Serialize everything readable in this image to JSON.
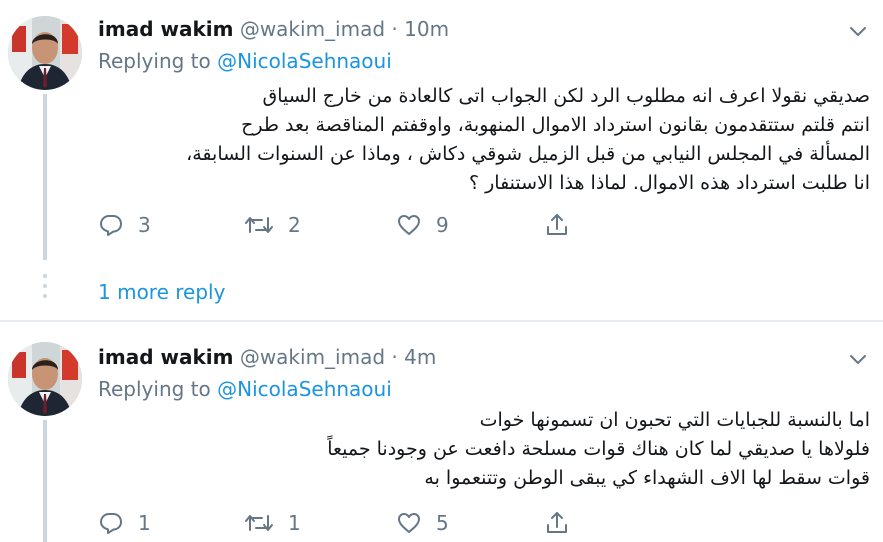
{
  "tweets": [
    {
      "author_name": "imad wakim",
      "handle": "@wakim_imad",
      "separator": "·",
      "time": "10m",
      "replying_prefix": "Replying to",
      "replying_to": "@NicolaSehnaoui",
      "lines": [
        "صديقي نقولا اعرف انه مطلوب  الرد لكن الجواب اتى كالعادة من خارج السياق",
        "انتم قلتم ستتقدمون بقانون استرداد الاموال المنهوبة، واوقفتم المناقصة بعد طرح",
        "المسألة في المجلس النيابي من قبل الزميل شوقي دكاش ، وماذا عن السنوات السابقة،",
        "انا طلبت استرداد هذه الاموال. لماذا هذا الاستنفار ؟"
      ],
      "reply_count": "3",
      "retweet_count": "2",
      "like_count": "9"
    },
    {
      "author_name": "imad wakim",
      "handle": "@wakim_imad",
      "separator": "·",
      "time": "4m",
      "replying_prefix": "Replying to",
      "replying_to": "@NicolaSehnaoui",
      "lines": [
        "اما بالنسبة للجبايات التي تحبون ان تسمونها خوات",
        "فلولاها يا صديقي لما كان هناك قوات مسلحة دافعت عن وجودنا جميعاً",
        "قوات سقط لها الاف الشهداء كي يبقى الوطن وتتنعموا به"
      ],
      "reply_count": "1",
      "retweet_count": "1",
      "like_count": "5"
    }
  ],
  "more_replies_label": "1 more reply",
  "icons": {
    "reply": "reply-icon",
    "retweet": "retweet-icon",
    "like": "heart-icon",
    "share": "share-icon",
    "menu": "chevron-down-icon"
  },
  "colors": {
    "link": "#1b95e0",
    "secondary": "#657786",
    "thread_line": "#ccd6dd",
    "divider": "#e6ecf0"
  }
}
